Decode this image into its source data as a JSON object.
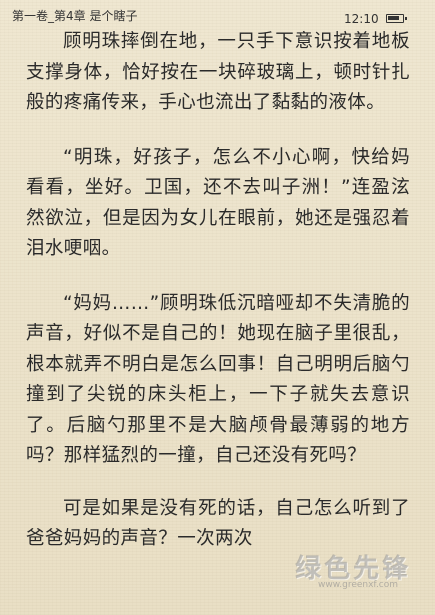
{
  "status_bar": {
    "chapter_title": "第一卷_第4章 是个瞎子",
    "time": "12:10",
    "battery_level": 0.85
  },
  "paragraphs": [
    "顾明珠摔倒在地，一只手下意识按着地板支撑身体，恰好按在一块碎玻璃上，顿时针扎般的疼痛传来，手心也流出了黏黏的液体。",
    "“明珠，好孩子，怎么不小心啊，快给妈看看，坐好。卫国，还不去叫子洲！”连盈泫然欲泣，但是因为女儿在眼前，她还是强忍着泪水哽咽。",
    "“妈妈……”顾明珠低沉暗哑却不失清脆的声音，好似不是自己的！她现在脑子里很乱，根本就弄不明白是怎么回事！自己明明后脑勺撞到了尖锐的床头柜上，一下子就失去意识了。后脑勺那里不是大脑颅骨最薄弱的地方吗？那样猛烈的一撞，自己还没有死吗？",
    "可是如果是没有死的话，自己怎么听到了爸爸妈妈的声音？一次两次"
  ],
  "watermark": {
    "text": "绿色先锋",
    "url": "www.greenxf.com"
  }
}
